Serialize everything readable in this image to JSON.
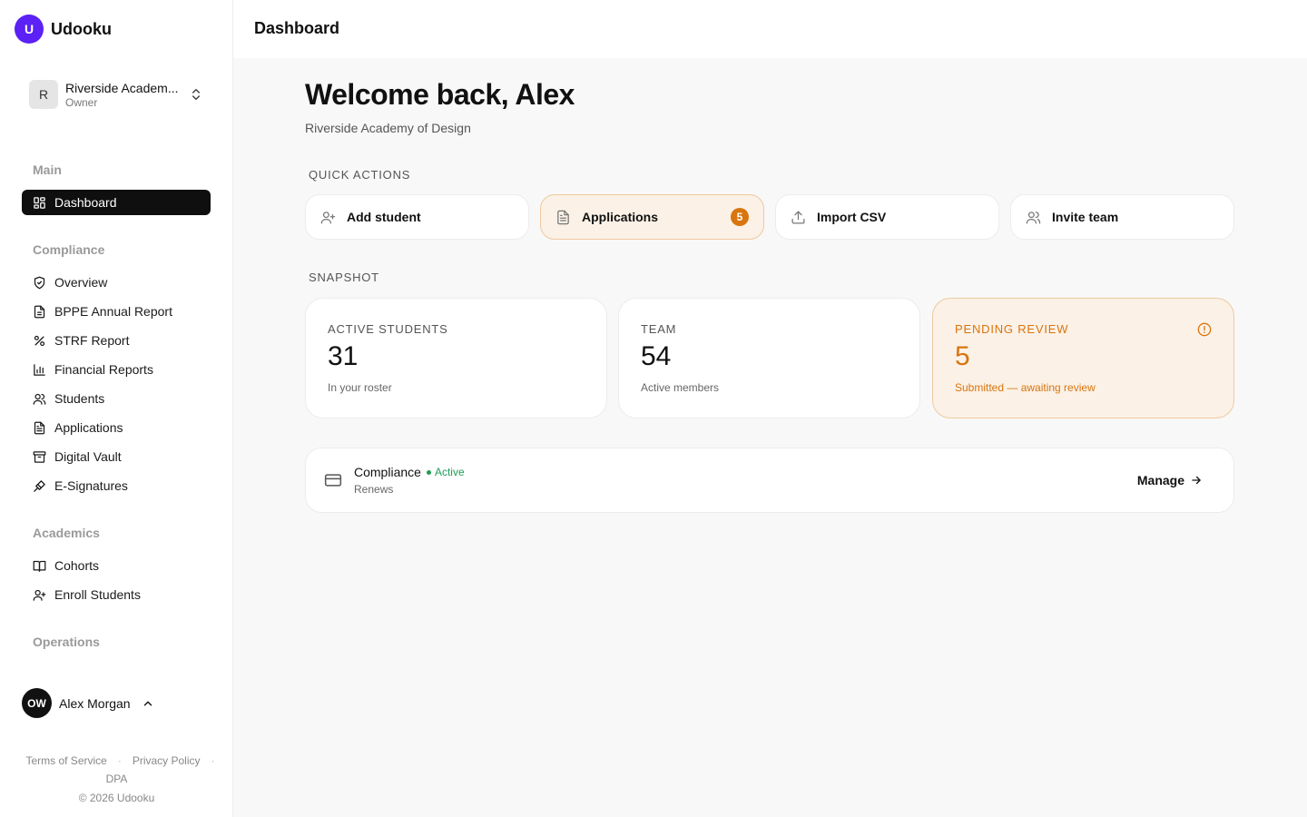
{
  "brand": {
    "logo_letter": "U",
    "name": "Udooku",
    "accent": "#5b21f5"
  },
  "org": {
    "avatar_letter": "R",
    "name": "Riverside Academ...",
    "role": "Owner"
  },
  "sidebar": {
    "sections": [
      {
        "title": "Main"
      },
      {
        "title": "Compliance"
      },
      {
        "title": "Academics"
      },
      {
        "title": "Operations"
      }
    ],
    "items": [
      {
        "label": "Dashboard",
        "icon": "dashboard-icon",
        "active": true
      },
      {
        "label": "Overview",
        "icon": "shield-icon"
      },
      {
        "label": "BPPE Annual Report",
        "icon": "document-icon"
      },
      {
        "label": "STRF Report",
        "icon": "percent-icon"
      },
      {
        "label": "Financial Reports",
        "icon": "bar-chart-icon"
      },
      {
        "label": "Students",
        "icon": "users-icon"
      },
      {
        "label": "Applications",
        "icon": "file-text-icon"
      },
      {
        "label": "Digital Vault",
        "icon": "archive-icon"
      },
      {
        "label": "E-Signatures",
        "icon": "signature-icon"
      },
      {
        "label": "Cohorts",
        "icon": "book-icon"
      },
      {
        "label": "Enroll Students",
        "icon": "user-plus-icon"
      }
    ]
  },
  "user": {
    "initials": "OW",
    "name": "Alex Morgan"
  },
  "footer": {
    "terms": "Terms of Service",
    "privacy": "Privacy Policy",
    "dpa": "DPA",
    "copyright": "© 2026 Udooku"
  },
  "header": {
    "title": "Dashboard"
  },
  "main": {
    "welcome": "Welcome back, Alex",
    "subtitle": "Riverside Academy of Design",
    "quick_actions_label": "QUICK ACTIONS",
    "quick_actions": [
      {
        "label": "Add student",
        "icon": "user-plus-icon"
      },
      {
        "label": "Applications",
        "icon": "file-text-icon",
        "badge": "5"
      },
      {
        "label": "Import CSV",
        "icon": "upload-icon"
      },
      {
        "label": "Invite team",
        "icon": "users-icon"
      }
    ],
    "snapshot_label": "SNAPSHOT",
    "snapshot": [
      {
        "label": "ACTIVE STUDENTS",
        "value": "31",
        "sub": "In your roster"
      },
      {
        "label": "TEAM",
        "value": "54",
        "sub": "Active members"
      },
      {
        "label": "PENDING REVIEW",
        "value": "5",
        "sub": "Submitted — awaiting review",
        "icon": "alert-circle-icon",
        "color": "#d9750f"
      }
    ],
    "compliance": {
      "title": "Compliance",
      "status": "Active",
      "sub": "Renews",
      "action": "Manage",
      "status_color": "#1f9d57"
    }
  }
}
